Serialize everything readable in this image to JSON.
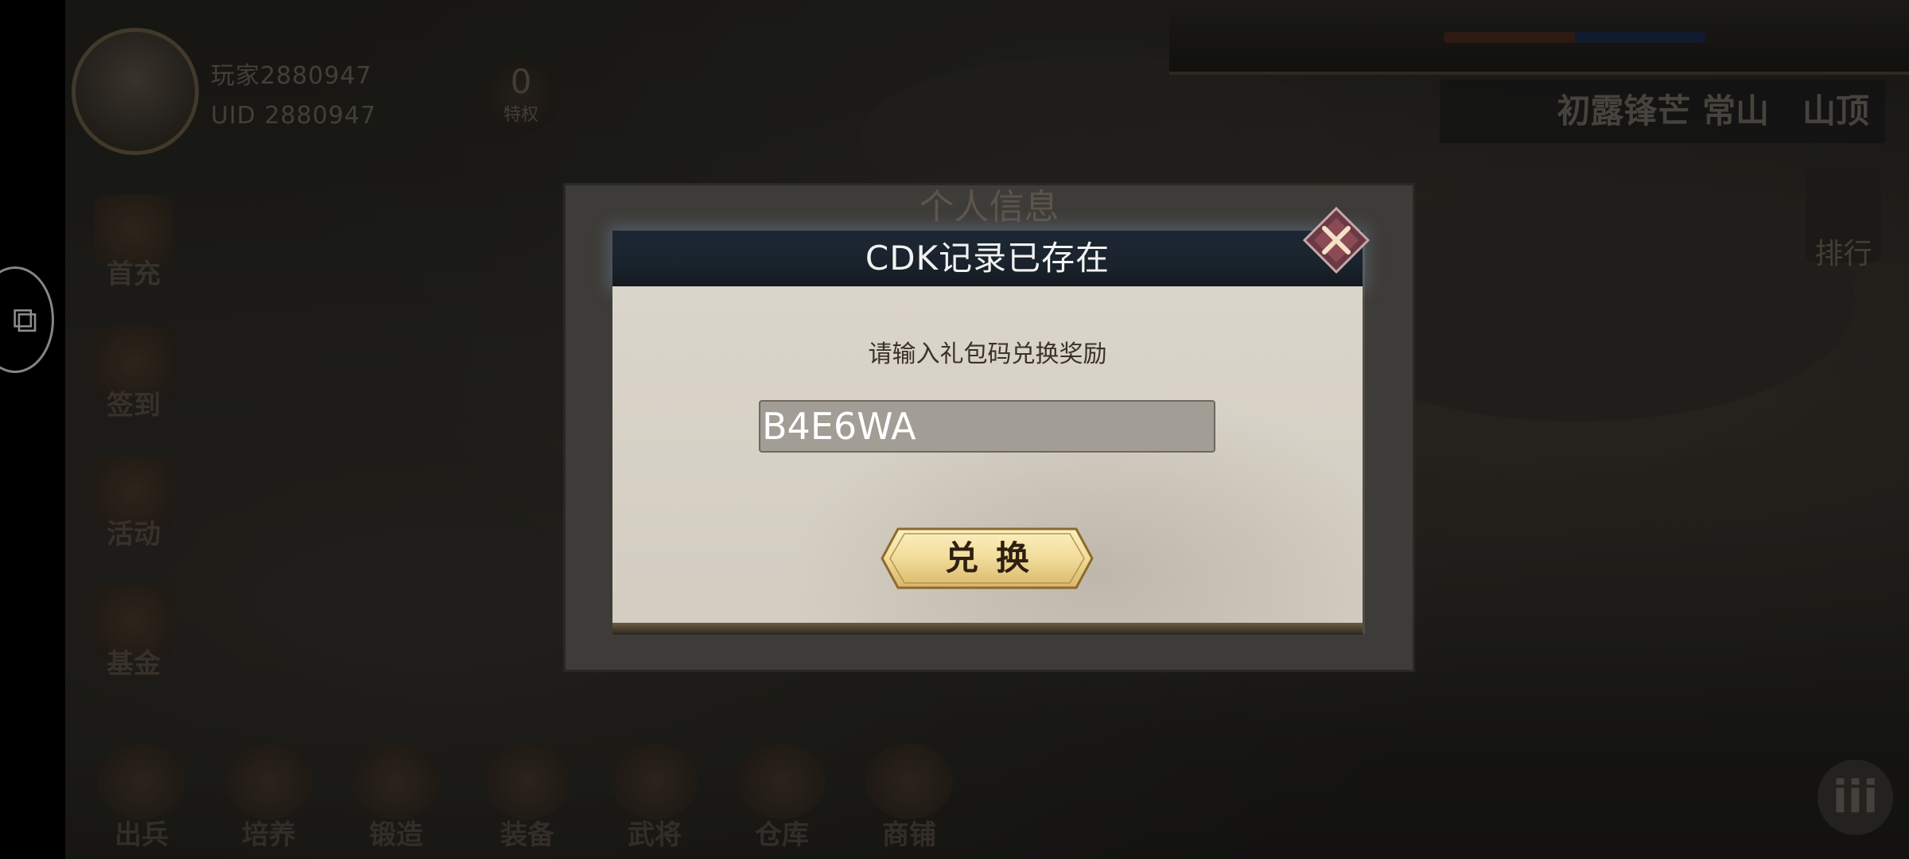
{
  "player": {
    "name": "玩家2880947",
    "uid": "UID 2880947",
    "vip_level": "0",
    "vip_label": "特权"
  },
  "location": "初露锋芒 常山　山顶",
  "rank_label": "排行",
  "left_menu": [
    {
      "label": "首充",
      "icon": "gift-icon"
    },
    {
      "label": "签到",
      "icon": "sign-in-icon"
    },
    {
      "label": "活动",
      "icon": "activity-icon"
    },
    {
      "label": "基金",
      "icon": "fund-icon"
    }
  ],
  "bottom_menu": [
    {
      "label": "出兵",
      "icon": "dispatch-icon"
    },
    {
      "label": "培养",
      "icon": "train-icon"
    },
    {
      "label": "锻造",
      "icon": "forge-icon"
    },
    {
      "label": "装备",
      "icon": "equipment-icon"
    },
    {
      "label": "武将",
      "icon": "general-icon"
    },
    {
      "label": "仓库",
      "icon": "warehouse-icon"
    },
    {
      "label": "商铺",
      "icon": "shop-icon"
    }
  ],
  "back_panel": {
    "title": "个人信息"
  },
  "dialog": {
    "title": "CDK记录已存在",
    "prompt": "请输入礼包码兑换奖励",
    "code_value": "B4E6WA",
    "redeem_label": "兑换"
  },
  "colors": {
    "dialog_header": "#1d2733",
    "dialog_body": "#d8d3c8",
    "button_gold": "#f1dc9a",
    "input_bg": "#a29d95"
  }
}
